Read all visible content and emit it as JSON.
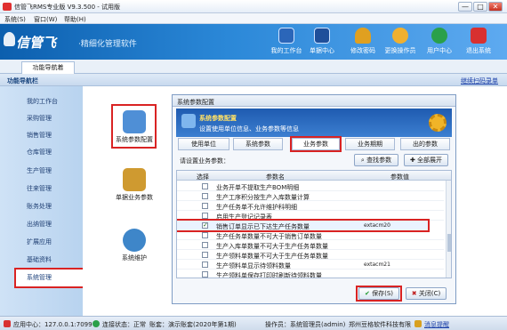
{
  "window": {
    "title": "信管飞RMS专业版 V9.3.500 - 试用版",
    "min": "—",
    "max": "□",
    "close": "✕"
  },
  "menu": {
    "items": [
      "系统(S)",
      "窗口(W)",
      "帮助(H)"
    ]
  },
  "banner": {
    "logo": "信管飞",
    "slogan": "·精细化管理软件",
    "tools": [
      {
        "label": "我的工作台",
        "color": "#2b66b9"
      },
      {
        "label": "单据中心",
        "color": "#1f4f9a"
      },
      {
        "label": "修改密码",
        "color": "#e0a020"
      },
      {
        "label": "更换操作员",
        "color": "#f0b030"
      },
      {
        "label": "用户中心",
        "color": "#2aa04a"
      },
      {
        "label": "退出系统",
        "color": "#d83030"
      }
    ]
  },
  "tabs": {
    "active": "功能导航着"
  },
  "nav": {
    "title": "功能导航栏",
    "restore_link": "继续扫码录单"
  },
  "sidebar": {
    "items": [
      "我的工作台",
      "采购管理",
      "销售管理",
      "仓库管理",
      "生产管理",
      "往来管理",
      "账务处理",
      "出纳管理",
      "扩展应用",
      "基础资料",
      "系统管理"
    ],
    "active_index": 10
  },
  "modules": [
    {
      "label": "系统参数配置",
      "color": "#4f8fd6"
    },
    {
      "label": "单据业务参数",
      "color": "#cf9a30"
    },
    {
      "label": "系统维护",
      "color": "#3e86c9"
    }
  ],
  "dialog": {
    "title": "系统参数配置",
    "header_title": "系统参数配置",
    "header_desc": "设置使用单位信息、业务参数等信息",
    "tabs": [
      "使用单位",
      "系统参数",
      "业务参数",
      "业务期期",
      "出的参数"
    ],
    "active_tab": 2,
    "prompt": "请设置业务参数：",
    "btn_find": "查找参数",
    "btn_expand": "全部展开",
    "columns": [
      "选择",
      "参数名",
      "参数值"
    ],
    "rows": [
      {
        "name": "业务开单不提取生产BOM明细",
        "value": "",
        "checked": false
      },
      {
        "name": "生产工序积分按生产入库数量计算",
        "value": "",
        "checked": false
      },
      {
        "name": "生产任务单不允许维护科明细",
        "value": "",
        "checked": false
      },
      {
        "name": "启用生产登记记录表",
        "value": "",
        "checked": false
      },
      {
        "name": "销售订单显示已下达生产任务数量",
        "value": "extacm20",
        "checked": true,
        "highlight": true
      },
      {
        "name": "生产任务单数量不可大于销售订单数量",
        "value": "",
        "checked": false
      },
      {
        "name": "生产入库单数量不可大于生产任务单数量",
        "value": "",
        "checked": false
      },
      {
        "name": "生产领料单数量不可大于生产任务单数量",
        "value": "",
        "checked": false
      },
      {
        "name": "生产领料单显示待领料数量",
        "value": "extacm21",
        "checked": false
      },
      {
        "name": "生产领料单保存打印时刷新待领料数量",
        "value": "",
        "checked": false
      }
    ],
    "row_mark": "I",
    "save": "保存(S)",
    "close": "关闭(C)"
  },
  "status": {
    "app_center": "应用中心：127.0.0.1:7099",
    "conn": "连接状态：正常",
    "account": "账套：演示账套(2020年第1期)",
    "operator": "操作员：系统管理员(admin)",
    "company": "郑州豆格软件科技有限",
    "message": "消息提醒"
  }
}
